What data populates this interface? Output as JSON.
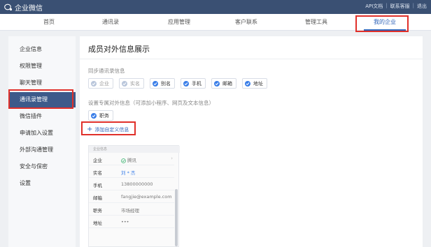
{
  "topbar": {
    "brand": "企业微信",
    "links": [
      "API文档",
      "联系客服",
      "退出"
    ]
  },
  "nav": {
    "items": [
      "首页",
      "通讯录",
      "应用管理",
      "客户联系",
      "管理工具",
      "我的企业"
    ],
    "active": "我的企业"
  },
  "sidebar": {
    "items": [
      "企业信息",
      "权限管理",
      "聊天管理",
      "通讯录管理",
      "微信插件",
      "申请加入设置",
      "外部沟通管理",
      "安全与保密",
      "设置"
    ],
    "active": "通讯录管理"
  },
  "main": {
    "title": "成员对外信息展示",
    "sync_label": "同步通讯录信息",
    "sync_chips": [
      {
        "label": "企业",
        "checked": false
      },
      {
        "label": "实名",
        "checked": false
      },
      {
        "label": "别名",
        "checked": true
      },
      {
        "label": "手机",
        "checked": true
      },
      {
        "label": "邮箱",
        "checked": true
      },
      {
        "label": "地址",
        "checked": true
      }
    ],
    "custom_label": "设置专属对外信息（可添加小程序、网页及文本信息）",
    "custom_chips": [
      {
        "label": "职务",
        "checked": true
      }
    ],
    "add_custom": "添加自定义信息"
  },
  "preview": {
    "header": "企业信息",
    "rows": [
      {
        "key": "企业",
        "value": "腾讯",
        "verified": true,
        "arrow": "›"
      },
      {
        "key": "实名",
        "value": "刘 * 杰",
        "link": true
      },
      {
        "key": "手机",
        "value": "13800000000"
      },
      {
        "key": "邮箱",
        "value": "fangjie@example.com"
      },
      {
        "key": "职务",
        "value": "市场经理"
      },
      {
        "key": "地址",
        "value": "•••"
      }
    ]
  },
  "colors": {
    "topbar": "#3a5073",
    "accent": "#2d62b8",
    "highlight": "#e0302a",
    "sidebar_active": "#3d5a8a"
  }
}
